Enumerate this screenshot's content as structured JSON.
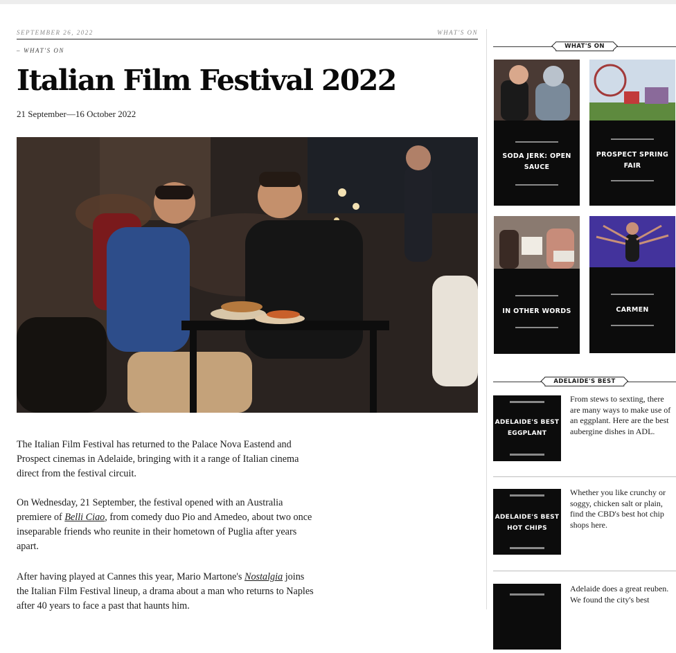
{
  "article": {
    "date": "SEPTEMBER 26, 2022",
    "section": "WHAT'S ON",
    "kicker_dash": "–",
    "kicker": "WHAT'S ON",
    "title": "Italian Film Festival 2022",
    "dates": "21 September—16 October 2022",
    "p1": "The Italian Film Festival has returned to the Palace Nova Eastend and Prospect cinemas in Adelaide, bringing with it a range of Italian cinema direct from the festival circuit.",
    "p2_a": "On Wednesday, 21 September, the festival opened with an Australia premiere of ",
    "p2_film": "Belli Ciao",
    "p2_b": ", from comedy duo Pio and Amedeo, about two once inseparable friends who reunite in their hometown of Puglia after years apart.",
    "p3_a": "After having played at Cannes this year, Mario Martone's ",
    "p3_film": "Nostalgia",
    "p3_b": " joins the Italian Film Festival lineup, a drama about a man who returns to Naples after 40 years to face a past that haunts him."
  },
  "sidebar": {
    "whats_on_label": "WHAT'S ON",
    "cards": [
      {
        "label": "SODA JERK: OPEN SAUCE"
      },
      {
        "label": "PROSPECT SPRING FAIR"
      },
      {
        "label": "IN OTHER WORDS"
      },
      {
        "label": "CARMEN"
      }
    ],
    "best_label": "ADELAIDE'S BEST",
    "best": [
      {
        "label": "ADELAIDE'S BEST EGGPLANT",
        "desc": "From stews to sexting, there are many ways to make use of an eggplant. Here are the best aubergine dishes in ADL."
      },
      {
        "label": "ADELAIDE'S BEST HOT CHIPS",
        "desc": "Whether you like crunchy or soggy, chicken salt or plain, find the CBD's best hot chip shops here."
      },
      {
        "label": "",
        "desc": "Adelaide does a great reuben. We found the city's best"
      }
    ]
  }
}
